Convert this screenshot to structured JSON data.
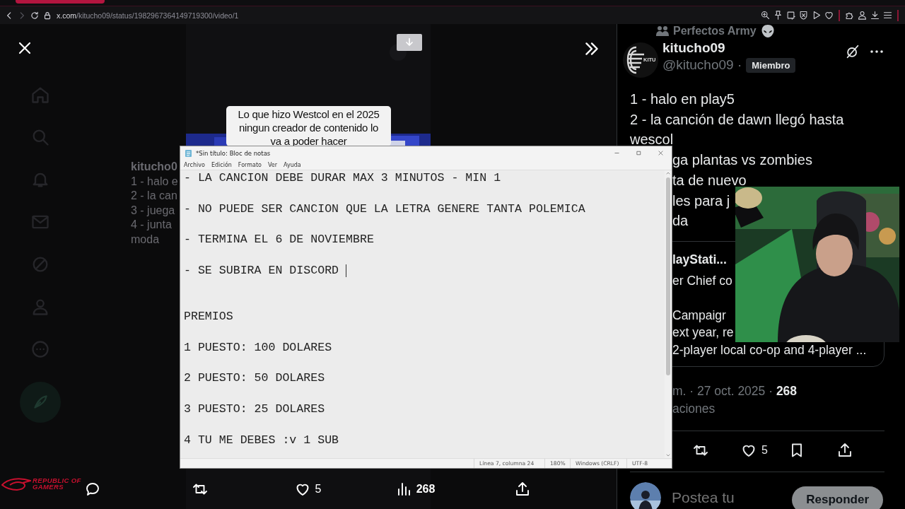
{
  "browser": {
    "url_host": "x.com",
    "url_path": "/kitucho09/status/1982967364149719300/video/1"
  },
  "background_post": {
    "author": "kitucho0",
    "lines": [
      "1 - halo e",
      "2 - la can",
      "3 - juega",
      "4 - junta",
      "moda"
    ]
  },
  "video": {
    "caption_lines": [
      "Lo que hizo Westcol en el 2025",
      "ningun creador de contenido lo",
      "va a poder hacer"
    ],
    "actions": [
      {
        "kind": "reply"
      },
      {
        "kind": "repost"
      },
      {
        "kind": "like",
        "count": "5"
      },
      {
        "kind": "views",
        "count": "268"
      },
      {
        "kind": "share"
      }
    ]
  },
  "overlay_logo": {
    "lines": [
      "REPUBLIC OF",
      "GAMERS"
    ]
  },
  "notepad": {
    "title": "*Sin título: Bloc de notas",
    "menu": [
      "Archivo",
      "Edición",
      "Formato",
      "Ver",
      "Ayuda"
    ],
    "rules": [
      "- LA CANCION DEBE DURAR MAX 3 MINUTOS - MIN 1",
      "- NO PUEDE SER CANCION QUE LA LETRA GENERE TANTA POLEMICA",
      "- TERMINA EL 6 DE NOVIEMBRE",
      "- SE SUBIRA EN DISCORD"
    ],
    "heading": "PREMIOS",
    "prizes": [
      "1 PUESTO: 100 DOLARES",
      "2 PUESTO: 50 DOLARES",
      "3 PUESTO: 25 DOLARES",
      "4 TU ME DEBES :v 1 SUB"
    ],
    "status": [
      "Línea 7, columna 24",
      "180%",
      "Windows (CRLF)",
      "UTF-8"
    ]
  },
  "post": {
    "community": "Perfectos Army",
    "avatar_label": "KITU",
    "name": "kitucho09",
    "handle": "@kitucho09 ·",
    "badge": "Miembro",
    "lines": [
      "1 -  halo en play5",
      "2 - la canción de dawn llegó hasta",
      "wescol"
    ],
    "lines_behind": [
      "ga plantas vs zombies",
      "ta de nuevo",
      "les para j",
      "da"
    ],
    "quote": {
      "title": "layStati...",
      "paragraphs": [
        [
          "er Chief co"
        ],
        [
          "Campaigr",
          "ext year, re",
          "2-player local co-op and 4-player ..."
        ]
      ]
    },
    "meta": "m. · 27 oct. 2025 · **268**",
    "meta_2": "aciones",
    "actions": [
      {
        "kind": "repost"
      },
      {
        "kind": "like",
        "count": "5"
      },
      {
        "kind": "bookmark"
      },
      {
        "kind": "share"
      }
    ],
    "reply_placeholder": "Postea tu",
    "reply_button": "Responder"
  }
}
